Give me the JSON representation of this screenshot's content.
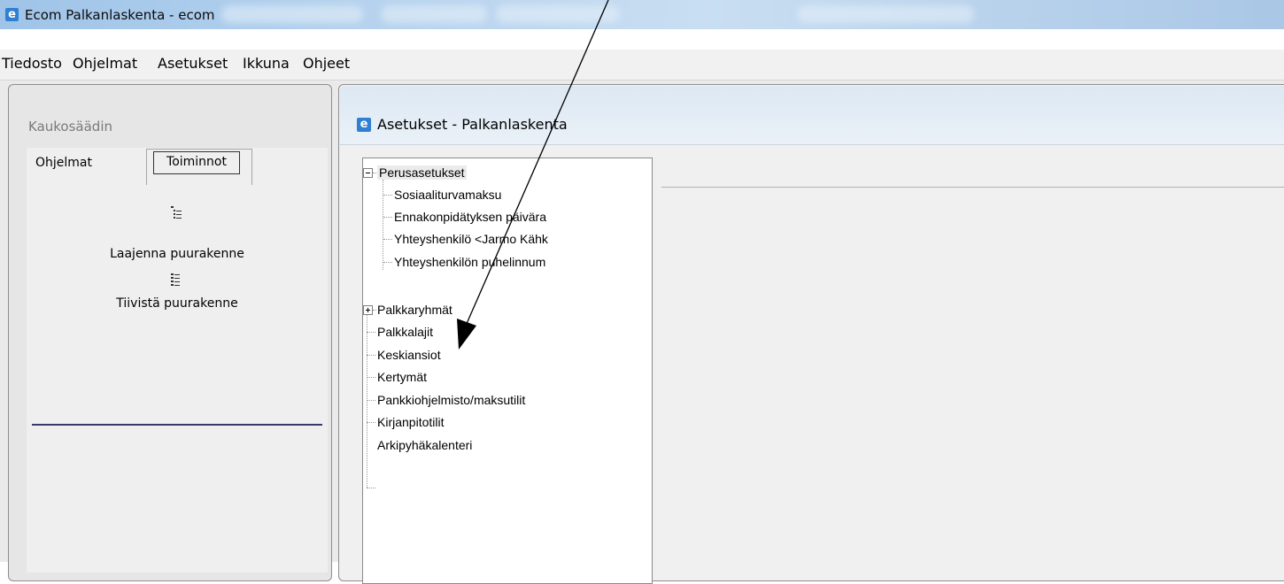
{
  "window": {
    "title": "Ecom Palkanlaskenta - ecom",
    "icon": "ecom-app-icon",
    "icon_glyph": "e"
  },
  "menu": [
    "Tiedosto",
    "Ohjelmat",
    "Asetukset",
    "Ikkuna",
    "Ohjeet"
  ],
  "left_panel": {
    "title": "Kaukosäädin",
    "tabs": [
      "Ohjelmat",
      "Toiminnot"
    ],
    "active_tab": "Toiminnot",
    "actions": [
      {
        "label": "Laajenna puurakenne",
        "icon": "expand-tree-icon"
      },
      {
        "label": "Tiivistä puurakenne",
        "icon": "collapse-tree-icon"
      }
    ]
  },
  "right_panel": {
    "title": "Asetukset - Palkanlaskenta",
    "icon_glyph": "e",
    "tree": {
      "root_expanded": {
        "label": "Perusasetukset",
        "children": [
          "Sosiaaliturvamaksu",
          "Ennakonpidätyksen päivära",
          "Yhteyshenkilö <Jarmo Kähk",
          "Yhteyshenkilön puhelinnum"
        ]
      },
      "root_collapsed": "Palkkaryhmät",
      "items": [
        "Palkkalajit",
        "Keskiansiot",
        "Kertymät",
        "Pankkiohjelmisto/maksutilit",
        "Kirjanpitotilit",
        "Arkipyhäkalenteri"
      ]
    }
  },
  "colors": {
    "titlebar": "#b7d3ee",
    "icon_blue": "#2f7fd2",
    "separator": "#3a3a6a"
  }
}
